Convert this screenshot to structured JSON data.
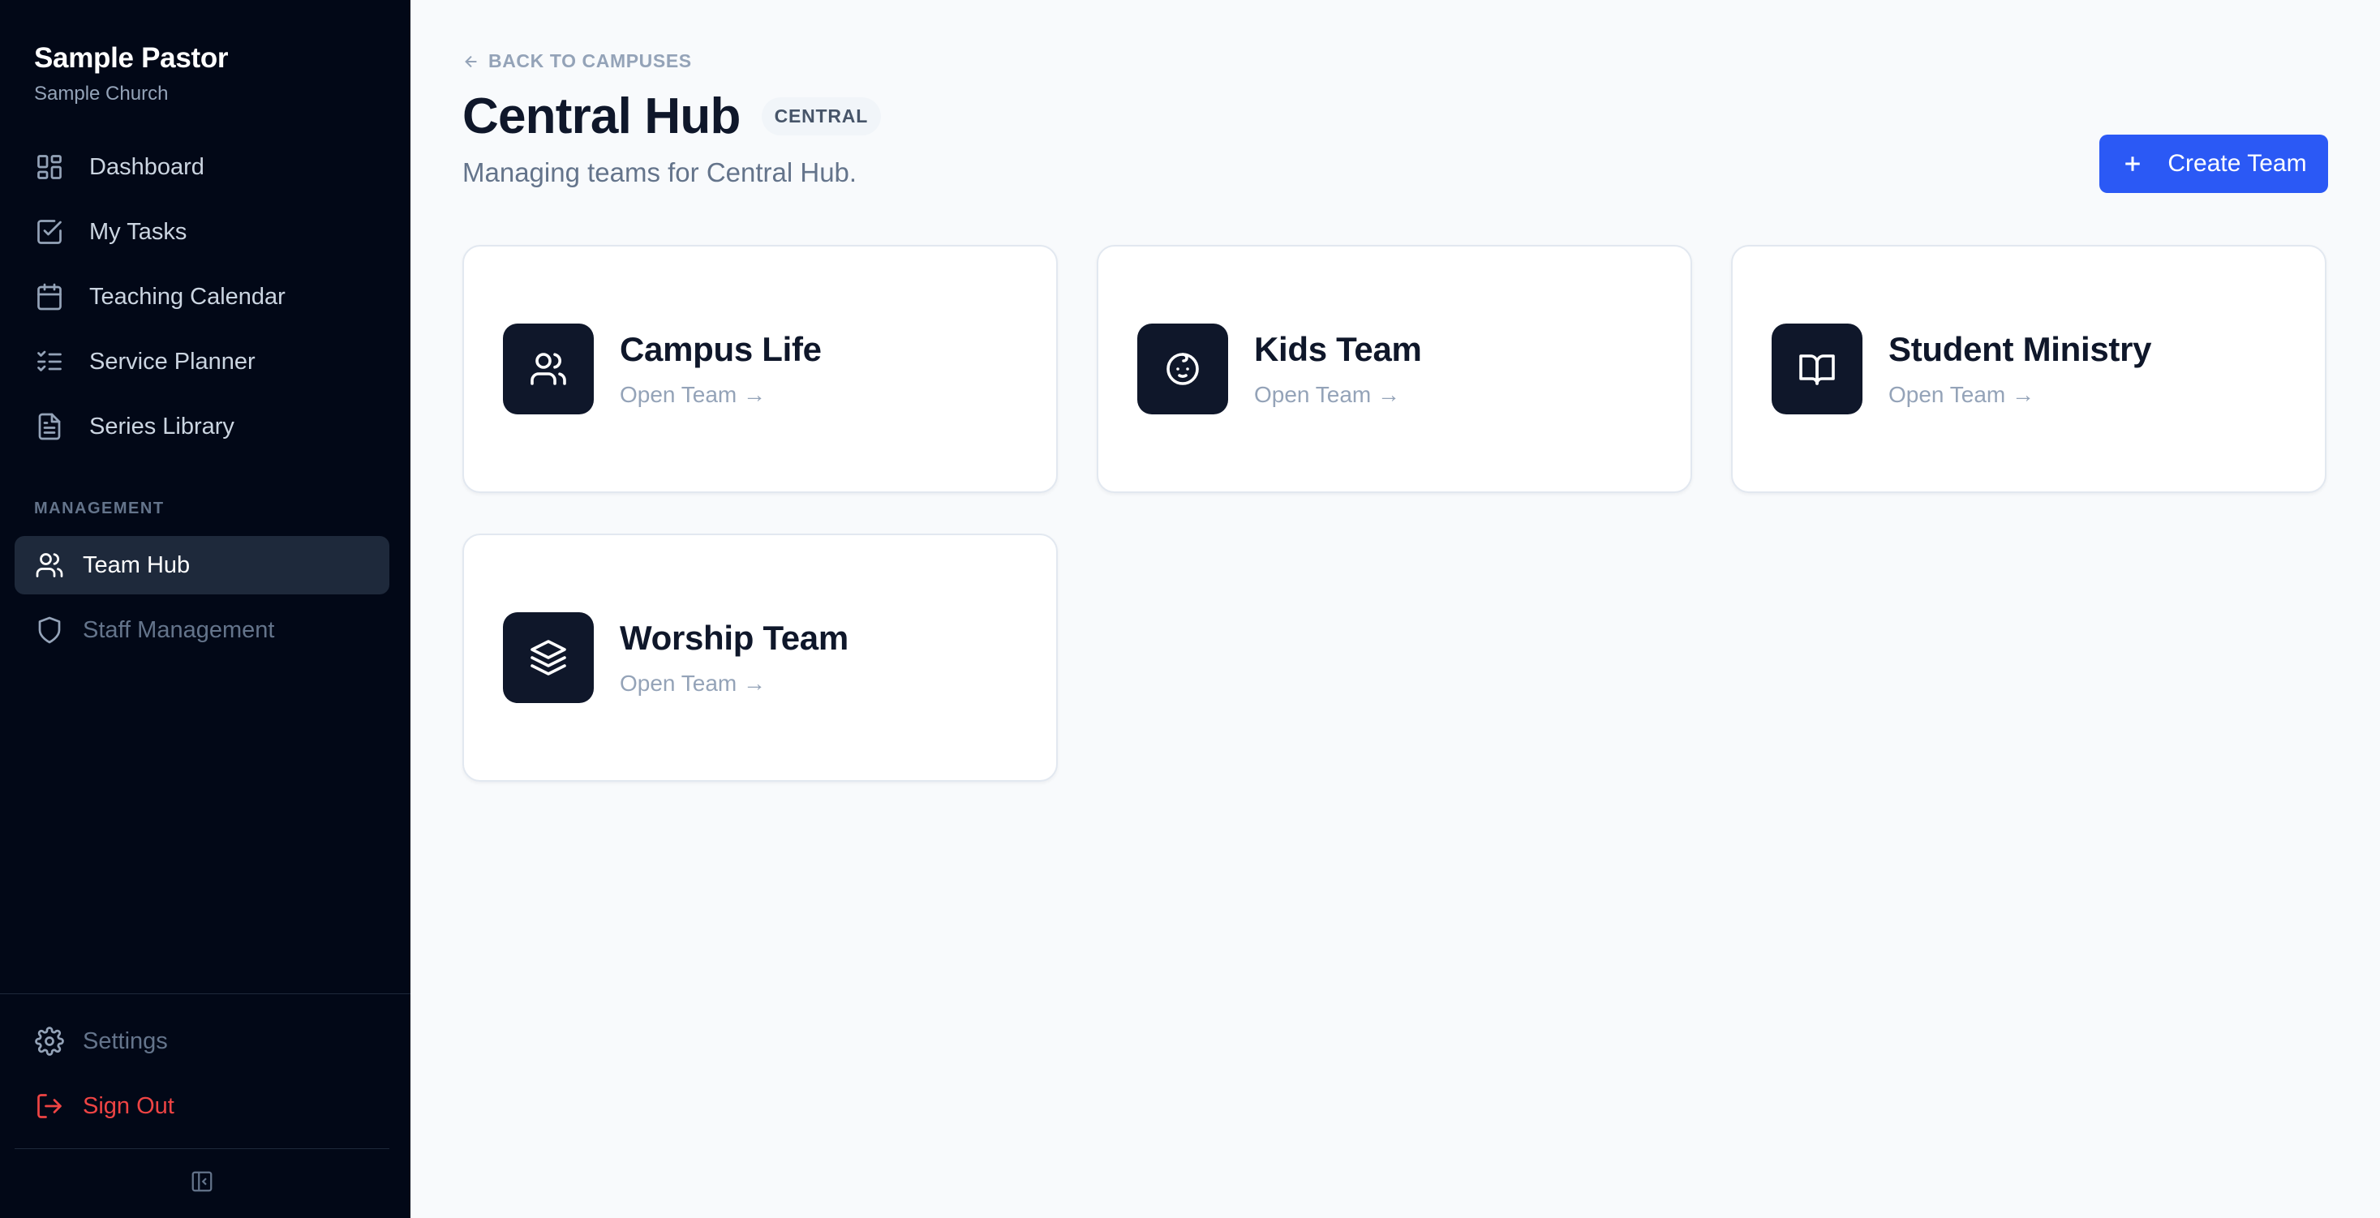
{
  "sidebar": {
    "user_name": "Sample Pastor",
    "church_name": "Sample Church",
    "nav": [
      {
        "label": "Dashboard",
        "icon": "dashboard-icon"
      },
      {
        "label": "My Tasks",
        "icon": "checkbox-icon"
      },
      {
        "label": "Teaching Calendar",
        "icon": "calendar-icon"
      },
      {
        "label": "Service Planner",
        "icon": "list-checks-icon"
      },
      {
        "label": "Series Library",
        "icon": "document-icon"
      }
    ],
    "management_label": "MANAGEMENT",
    "management": [
      {
        "label": "Team Hub",
        "icon": "users-icon",
        "active": true
      },
      {
        "label": "Staff Management",
        "icon": "shield-icon"
      }
    ],
    "settings_label": "Settings",
    "signout_label": "Sign Out"
  },
  "header": {
    "back_label": "BACK TO CAMPUSES",
    "title": "Central Hub",
    "badge": "CENTRAL",
    "subtitle": "Managing teams for Central Hub.",
    "create_label": "Create Team"
  },
  "teams": [
    {
      "name": "Campus Life",
      "link": "Open Team →",
      "icon": "users-icon"
    },
    {
      "name": "Kids Team",
      "link": "Open Team →",
      "icon": "baby-face-icon"
    },
    {
      "name": "Student Ministry",
      "link": "Open Team →",
      "icon": "book-open-icon"
    },
    {
      "name": "Worship Team",
      "link": "Open Team →",
      "icon": "layers-icon"
    }
  ],
  "colors": {
    "sidebar_bg": "#020817",
    "accent": "#2b59f5",
    "danger": "#ef4444",
    "card_icon_bg": "#0f172a"
  }
}
